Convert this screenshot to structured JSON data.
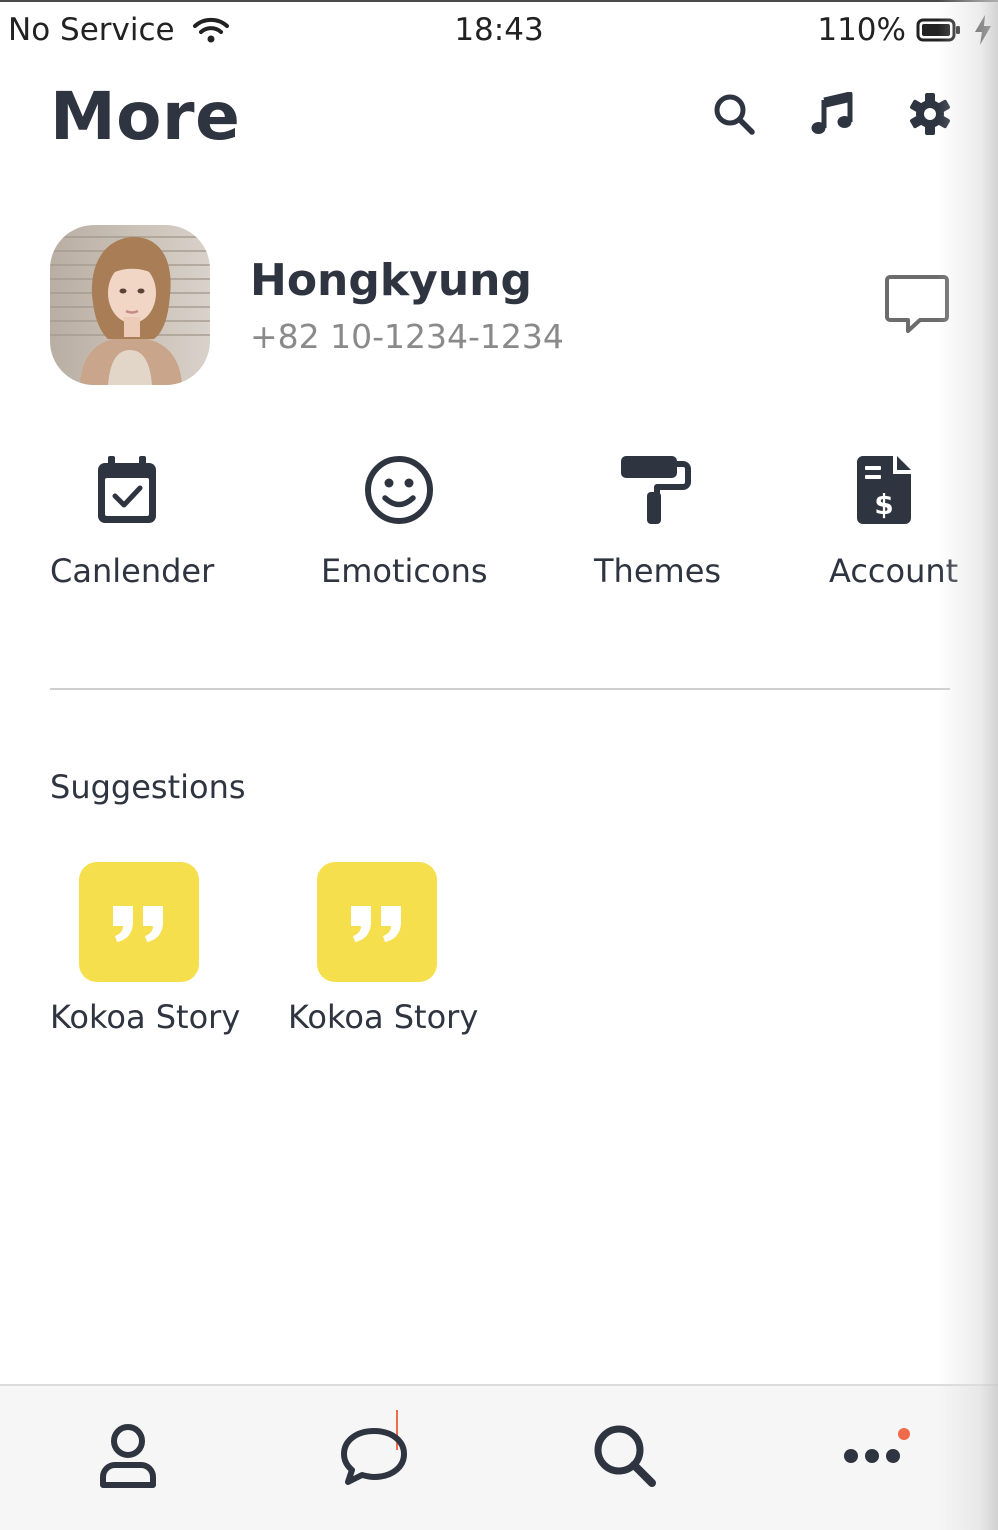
{
  "status_bar": {
    "carrier": "No Service",
    "time": "18:43",
    "battery": "110%"
  },
  "header": {
    "title": "More",
    "icons": [
      "search-icon",
      "music-icon",
      "gear-icon"
    ]
  },
  "profile": {
    "name": "Hongkyung",
    "phone": "+82 10-1234-1234",
    "avatar": "profile-photo",
    "action_icon": "chat-bubble-icon"
  },
  "shortcuts": [
    {
      "label": "Canlender",
      "icon": "calendar-check-icon"
    },
    {
      "label": "Emoticons",
      "icon": "smile-icon"
    },
    {
      "label": "Themes",
      "icon": "paint-roller-icon"
    },
    {
      "label": "Account",
      "icon": "invoice-dollar-icon"
    }
  ],
  "suggestions": {
    "title": "Suggestions",
    "items": [
      {
        "label": "Kokoa Story",
        "icon": "quote-icon"
      },
      {
        "label": "Kokoa Story",
        "icon": "quote-icon"
      }
    ]
  },
  "tab_bar": {
    "tabs": [
      "person-icon",
      "chat-icon",
      "search-icon",
      "more-dots-icon"
    ]
  },
  "colors": {
    "text": "#2e3440",
    "muted": "#8a8a8a",
    "accent_yellow": "#f6df4d",
    "notification": "#ef6b4c",
    "divider": "#cfcfcf",
    "tab_bar_bg": "#f6f6f6"
  }
}
